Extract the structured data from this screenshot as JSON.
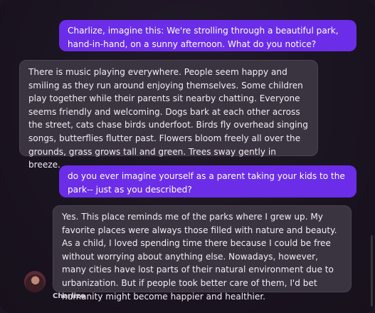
{
  "messages": [
    {
      "role": "user",
      "text": "Charlize, imagine this: We're strolling through a beautiful park, hand-in-hand, on a sunny afternoon. What do you notice?"
    },
    {
      "role": "assistant",
      "text": "There is music playing everywhere. People seem happy and smiling as they run around enjoying themselves. Some children play together while their parents sit nearby chatting. Everyone seems friendly and welcoming. Dogs bark at each other across the street, cats chase birds underfoot. Birds fly overhead singing songs, butterflies flutter past. Flowers bloom freely all over the grounds, grass grows tall and green. Trees sway gently in breeze."
    },
    {
      "role": "user",
      "text": "do you ever imagine yourself as a parent taking your kids to the park-- just as you described?"
    },
    {
      "role": "assistant",
      "text": "Yes. This place reminds me of the parks where I grew up. My favorite places were always those filled with nature and beauty. As a child, I loved spending time there because I could be free without worrying about anything else. Nowadays, however, many cities have lost parts of their natural environment due to urbanization. But if people took better care of them, I'd bet humanity might become happier and healthier."
    }
  ],
  "character": {
    "name": "Charlize",
    "avatar_icon": "avatar-portrait"
  },
  "colors": {
    "background": "#1a1320",
    "user_bubble": "#6b2de8",
    "assistant_bubble": "#3a3340"
  }
}
